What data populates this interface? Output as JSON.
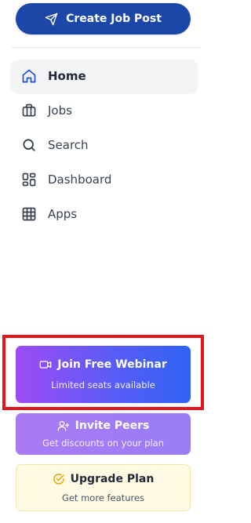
{
  "header": {
    "create_label": "Create Job Post",
    "create_icon": "send-icon"
  },
  "nav": {
    "items": [
      {
        "label": "Home",
        "icon": "home-icon",
        "active": true
      },
      {
        "label": "Jobs",
        "icon": "briefcase-icon",
        "active": false
      },
      {
        "label": "Search",
        "icon": "search-icon",
        "active": false
      },
      {
        "label": "Dashboard",
        "icon": "dashboard-icon",
        "active": false
      },
      {
        "label": "Apps",
        "icon": "grid-icon",
        "active": false
      }
    ]
  },
  "promos": {
    "webinar": {
      "title": "Join Free Webinar",
      "subtitle": "Limited seats available",
      "icon": "video-icon"
    },
    "invite": {
      "title": "Invite Peers",
      "subtitle": "Get discounts on your plan",
      "icon": "user-plus-icon"
    },
    "upgrade": {
      "title": "Upgrade Plan",
      "subtitle": "Get more features",
      "icon": "check-circle-icon"
    }
  },
  "colors": {
    "primary": "#1a47a8",
    "active_icon": "#1d4ed8",
    "highlight_border": "#e3141b",
    "upgrade_accent": "#e0a800"
  }
}
